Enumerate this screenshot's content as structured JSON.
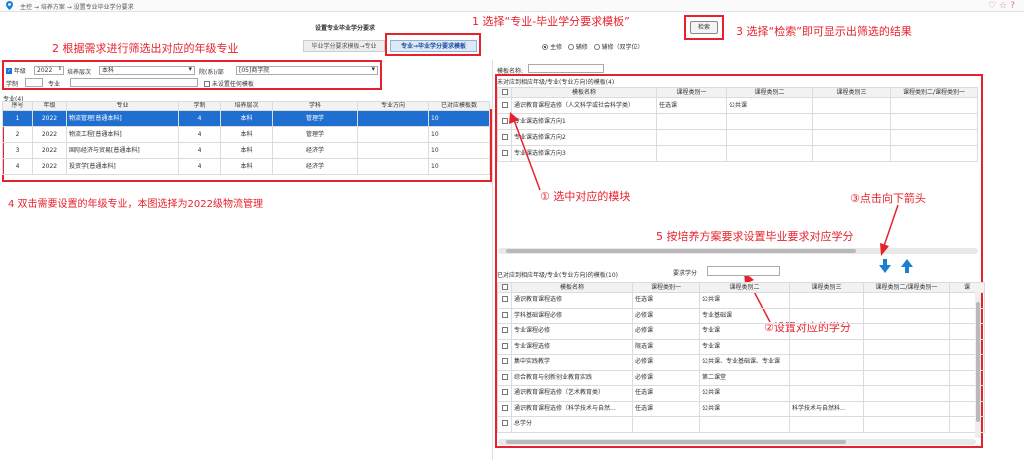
{
  "breadcrumb": "主控 → 培养方案 → 设置专业毕业学分要求",
  "page_title": "设置专业毕业学分要求",
  "tabs": [
    "毕业学分要求模板→专业",
    "专业→毕业学分要求模板"
  ],
  "search_button": "检索",
  "radios": [
    "主修",
    "辅修",
    "辅修（双学位）"
  ],
  "annotations": {
    "a1": "1 选择“专业-毕业学分要求模板”",
    "a2": "2 根据需求进行筛选出对应的年级专业",
    "a3": "3 选择“检索”即可显示出筛选的结果",
    "a4": "4 双击需要设置的年级专业，本图选择为2022级物流管理",
    "a5": "① 选中对应的模块",
    "a6": "③点击向下箭头",
    "a7": "5 按培养方案要求设置毕业要求对应学分",
    "a8": "②设置对应的学分"
  },
  "filters": {
    "grade_label": "年级",
    "grade_value": "2022",
    "level_label": "培养层次",
    "level_value": "本科",
    "dept_label": "院(系)/部",
    "dept_value": "[05]商学院",
    "system_label": "学制",
    "major_label": "专业",
    "unset_label": "未设置任何模板"
  },
  "left_table": {
    "caption": "专业(4)",
    "headers": [
      "序号",
      "年级",
      "专业",
      "学制",
      "培养层次",
      "学科",
      "专业方向",
      "已对应模板数"
    ],
    "rows": [
      [
        "1",
        "2022",
        "物流管理[普通本科]",
        "4",
        "本科",
        "管理学",
        "",
        "10"
      ],
      [
        "2",
        "2022",
        "物流工程[普通本科]",
        "4",
        "本科",
        "管理学",
        "",
        "10"
      ],
      [
        "3",
        "2022",
        "国际经济与贸易[普通本科]",
        "4",
        "本科",
        "经济学",
        "",
        "10"
      ],
      [
        "4",
        "2022",
        "投资学[普通本科]",
        "4",
        "本科",
        "经济学",
        "",
        "10"
      ]
    ]
  },
  "right_top": {
    "template_name_label": "模板名称:",
    "caption": "未对应到相应年级/专业(专业方向)的模板(4)",
    "headers": [
      "",
      "模板名称",
      "课程类别一",
      "课程类别二",
      "课程类别三",
      "课程类别二/课程类别一"
    ],
    "rows": [
      [
        "通识教育课程选修（人文科学或社会科学类）",
        "任选课",
        "公共课",
        "",
        ""
      ],
      [
        "专业课选修课方向1",
        "",
        "",
        "",
        ""
      ],
      [
        "专业课选修课方向2",
        "",
        "",
        "",
        ""
      ],
      [
        "专业课选修课方向3",
        "",
        "",
        "",
        ""
      ]
    ]
  },
  "right_bottom": {
    "caption": "已对应到相应年级/专业(专业方向)的模板(10)",
    "credit_label": "要求学分",
    "headers": [
      "",
      "模板名称",
      "课程类别一",
      "课程类别二",
      "课程类别三",
      "课程类别二/课程类别一",
      "课"
    ],
    "rows": [
      [
        "通识教育课程选修",
        "任选课",
        "公共课",
        "",
        ""
      ],
      [
        "学科基础课程必修",
        "必修课",
        "专业基础课",
        "",
        ""
      ],
      [
        "专业课程必修",
        "必修课",
        "专业课",
        "",
        ""
      ],
      [
        "专业课程选修",
        "限选课",
        "专业课",
        "",
        ""
      ],
      [
        "集中实践教学",
        "必修课",
        "公共课、专业基础课、专业课",
        "",
        ""
      ],
      [
        "综合教育与创新创业教育实践",
        "必修课",
        "第二课堂",
        "",
        ""
      ],
      [
        "通识教育课程选修（艺术教育类）",
        "任选课",
        "公共课",
        "",
        ""
      ],
      [
        "通识教育课程选修（科学技术与自然...",
        "任选课",
        "公共课",
        "科学技术与自然科...",
        ""
      ],
      [
        "总学分",
        "",
        "",
        "",
        ""
      ]
    ]
  },
  "colors": {
    "accent_red": "#e8222d",
    "selection_blue": "#1f6fd1",
    "arrow_blue": "#1a7fd4"
  },
  "icons": [
    "location-pin-icon",
    "heart-icon",
    "star-icon",
    "help-icon",
    "arrow-down-icon",
    "arrow-up-icon"
  ]
}
